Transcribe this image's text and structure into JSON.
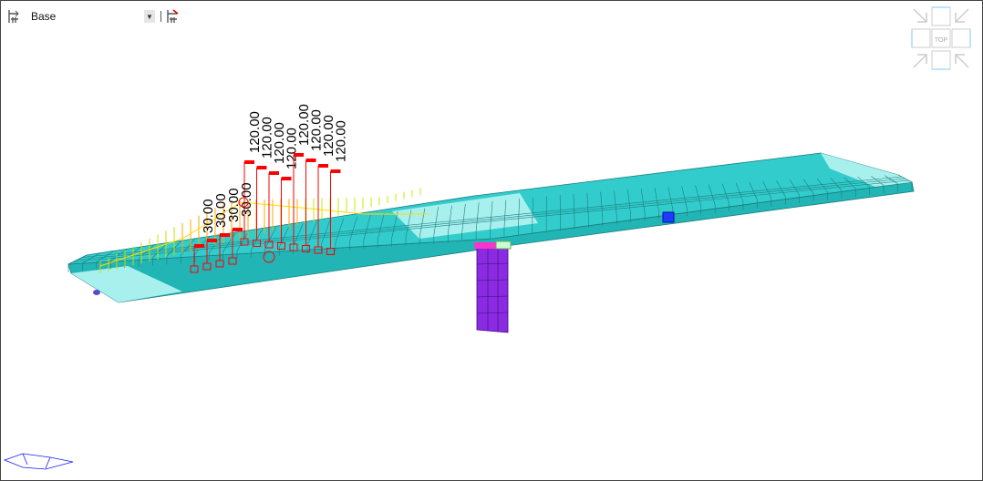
{
  "toolbar": {
    "stage_icon": "construction-stage-icon",
    "stage_value": "Base",
    "next_stage_icon": "construction-stage-next-icon"
  },
  "view_cube": {
    "center_label": "TOP"
  },
  "model": {
    "deck_color": "#33cccc",
    "deck_light_color": "#a8f0ee",
    "pier_color": "#8a2be2",
    "load_color": "#ff0000",
    "load_labels_high": [
      "120.00",
      "120.00",
      "120.00",
      "120.00",
      "120.00",
      "120.00",
      "120.00",
      "120.00"
    ],
    "load_labels_low": [
      "30.00",
      "30.00",
      "30.00",
      "30.00"
    ]
  }
}
